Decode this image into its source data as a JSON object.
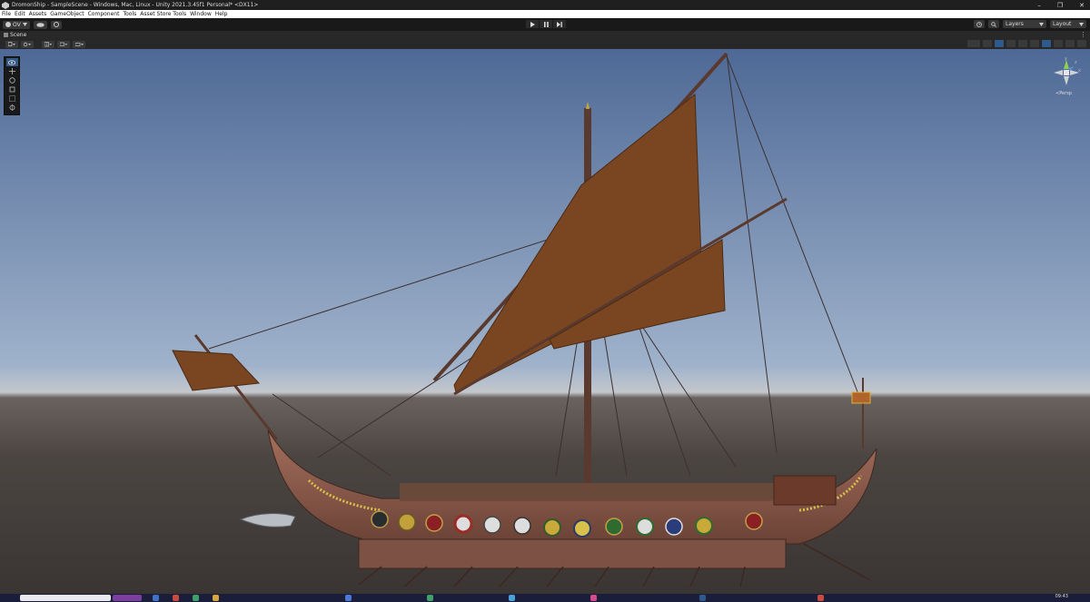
{
  "window": {
    "title": "DromonShip - SampleScene - Windows, Mac, Linux - Unity 2021.3.45f1 Personal* <DX11>",
    "minimize_glyph": "–",
    "maximize_glyph": "❐",
    "close_glyph": "✕"
  },
  "menu": {
    "items": [
      "File",
      "Edit",
      "Assets",
      "GameObject",
      "Component",
      "Tools",
      "Asset Store Tools",
      "Window",
      "Help"
    ]
  },
  "toolbar": {
    "account_label": "OV",
    "layers_label": "Layers",
    "layout_label": "Layout"
  },
  "scene_tab": {
    "label": "Scene"
  },
  "gizmo": {
    "x_label": "x",
    "y_label": "y",
    "z_label": "z",
    "projection_label": "≺Persp"
  },
  "taskbar": {
    "clock": "09:43"
  },
  "colors": {
    "sky_top": "#4e6996",
    "sky_horizon": "#c4c7cc",
    "ground": "#4b4542",
    "sail": "#7a4521",
    "hull": "#8a5a4b",
    "accent_blue": "#2e5b8b"
  }
}
